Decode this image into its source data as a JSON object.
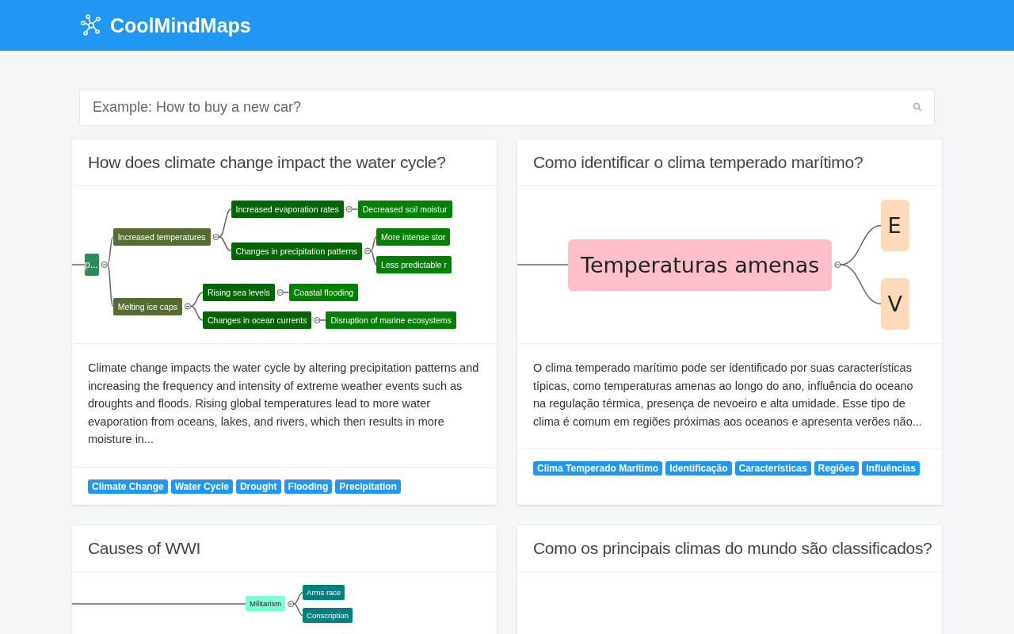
{
  "header": {
    "brand": "CoolMindMaps"
  },
  "search": {
    "placeholder": "Example: How to buy a new car?"
  },
  "cards": [
    {
      "title": "How does climate change impact the water cycle?",
      "map": {
        "root": {
          "text": "p...",
          "color": "#2e8b57",
          "children": [
            {
              "text": "Increased temperatures",
              "color": "#556b2f",
              "children": [
                {
                  "text": "Increased evaporation rates",
                  "color": "#006400",
                  "children": [
                    {
                      "text": "Decreased soil moistur",
                      "color": "#008000"
                    }
                  ]
                },
                {
                  "text": "Changes in precipitation patterns",
                  "color": "#006400",
                  "children": [
                    {
                      "text": "More intense stor",
                      "color": "#008000"
                    },
                    {
                      "text": "Less predictable r",
                      "color": "#008000"
                    }
                  ]
                }
              ]
            },
            {
              "text": "Melting ice caps",
              "color": "#556b2f",
              "children": [
                {
                  "text": "Rising sea levels",
                  "color": "#006400",
                  "children": [
                    {
                      "text": "Coastal flooding",
                      "color": "#008000"
                    }
                  ]
                },
                {
                  "text": "Changes in ocean currents",
                  "color": "#006400",
                  "children": [
                    {
                      "text": "Disruption of marine ecosystems",
                      "color": "#008000"
                    }
                  ]
                }
              ]
            }
          ]
        }
      },
      "description": "Climate change impacts the water cycle by altering precipitation patterns and increasing the frequency and intensity of extreme weather events such as droughts and floods. Rising global temperatures lead to more water evaporation from oceans, lakes, and rivers, which then results in more moisture in...",
      "tags": [
        "Climate Change",
        "Water Cycle",
        "Drought",
        "Flooding",
        "Precipitation"
      ]
    },
    {
      "title": "Como identificar o clima temperado marítimo?",
      "map": {
        "root": {
          "text": "Temperaturas amenas",
          "color": "#ffc0cb",
          "children": [
            {
              "text": "E",
              "color": "#ffdab9"
            },
            {
              "text": "V",
              "color": "#ffdab9"
            }
          ]
        }
      },
      "description": "O clima temperado marítimo pode ser identificado por suas características típicas, como temperaturas amenas ao longo do ano, influência do oceano na regulação térmica, presença de nevoeiro e alta umidade. Esse tipo de clima é comum em regiões próximas aos oceanos e apresenta verões não...",
      "tags": [
        "Clima Temperado Marítimo",
        "Identificação",
        "Características",
        "Regiões",
        "Influências"
      ]
    },
    {
      "title": "Causes of WWI",
      "map": {
        "root": {
          "text": "Militarism",
          "color": "#7fffd4",
          "children": [
            {
              "text": "Arms race",
              "color": "#008080"
            },
            {
              "text": "Conscription",
              "color": "#008080"
            }
          ]
        }
      }
    },
    {
      "title": "Como os principais climas do mundo são classificados?"
    }
  ]
}
